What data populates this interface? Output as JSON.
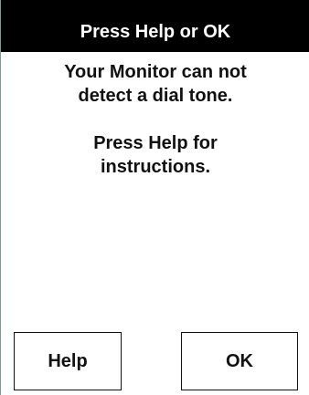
{
  "dialog": {
    "title": "Press Help or OK",
    "message_lines_1": [
      "Your Monitor can not",
      "detect a dial tone."
    ],
    "message_lines_2": [
      "Press Help for",
      "instructions."
    ]
  },
  "buttons": {
    "help_label": "Help",
    "ok_label": "OK"
  },
  "colors": {
    "title_bg": "#000000",
    "title_fg": "#ffffff",
    "body_bg": "#ffffff",
    "text": "#111111"
  }
}
